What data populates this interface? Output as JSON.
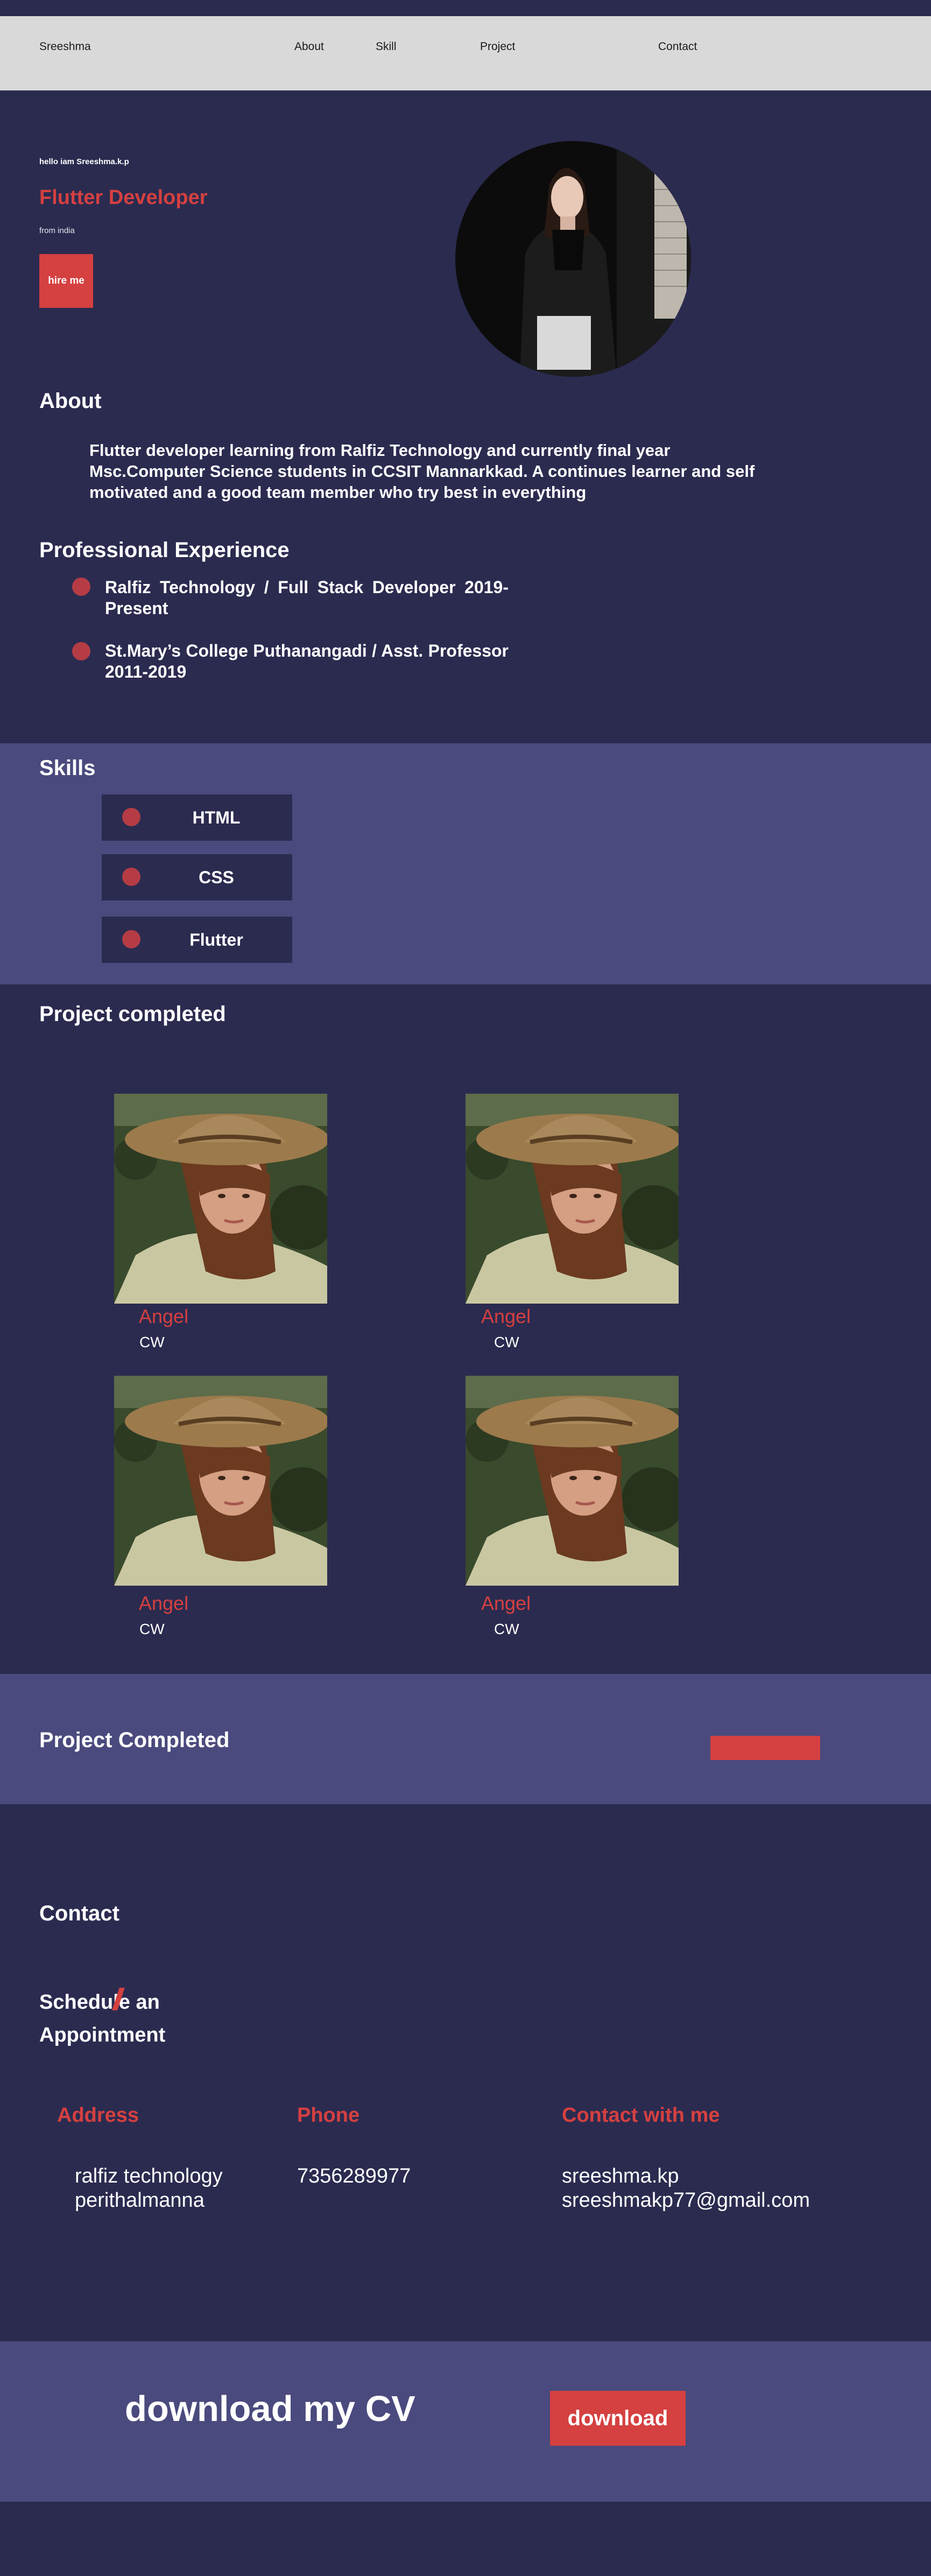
{
  "nav": {
    "brand": "Sreeshma",
    "links": [
      "About",
      "Skill",
      "Project",
      "Contact"
    ]
  },
  "hero": {
    "greeting": "hello iam Sreeshma.k.p",
    "role": "Flutter Developer",
    "location": "from india",
    "cta": "hire me"
  },
  "about": {
    "title": "About",
    "text": "Flutter developer learning from Ralfiz Technology and currently final year Msc.Computer Science students in CCSIT Mannarkkad. A continues learner and self motivated and a good team member who try best in everything"
  },
  "experience": {
    "title": "Professional Experience",
    "items": [
      "Ralfiz Technology / Full Stack Developer 2019-Present",
      "St.Mary’s College Puthanangadi / Asst. Professor 2011-2019"
    ]
  },
  "skills": {
    "title": "Skills",
    "items": [
      "HTML",
      "CSS",
      "Flutter"
    ]
  },
  "projects": {
    "title": "Project completed",
    "items": [
      {
        "name": "Angel",
        "sub": "CW"
      },
      {
        "name": "Angel",
        "sub": "CW"
      },
      {
        "name": "Angel",
        "sub": "CW"
      },
      {
        "name": "Angel",
        "sub": "CW"
      }
    ]
  },
  "projects_band": {
    "title": "Project Completed"
  },
  "contact": {
    "title": "Contact",
    "schedule_line1": "Schedule an",
    "schedule_line2": "Appointment",
    "address_head": "Address",
    "address_line1": "ralfiz technology",
    "address_line2": "perithalmanna",
    "phone_head": "Phone",
    "phone": "7356289977",
    "contact_head": "Contact with me",
    "contact_line1": "sreeshma.kp",
    "contact_line2": "sreeshmakp77@gmail.com"
  },
  "cv": {
    "title": "download my CV",
    "button": "download"
  },
  "colors": {
    "background": "#2b2b50",
    "band": "#4a4a7e",
    "accent": "#d54040",
    "nav": "#d9d9d9"
  }
}
